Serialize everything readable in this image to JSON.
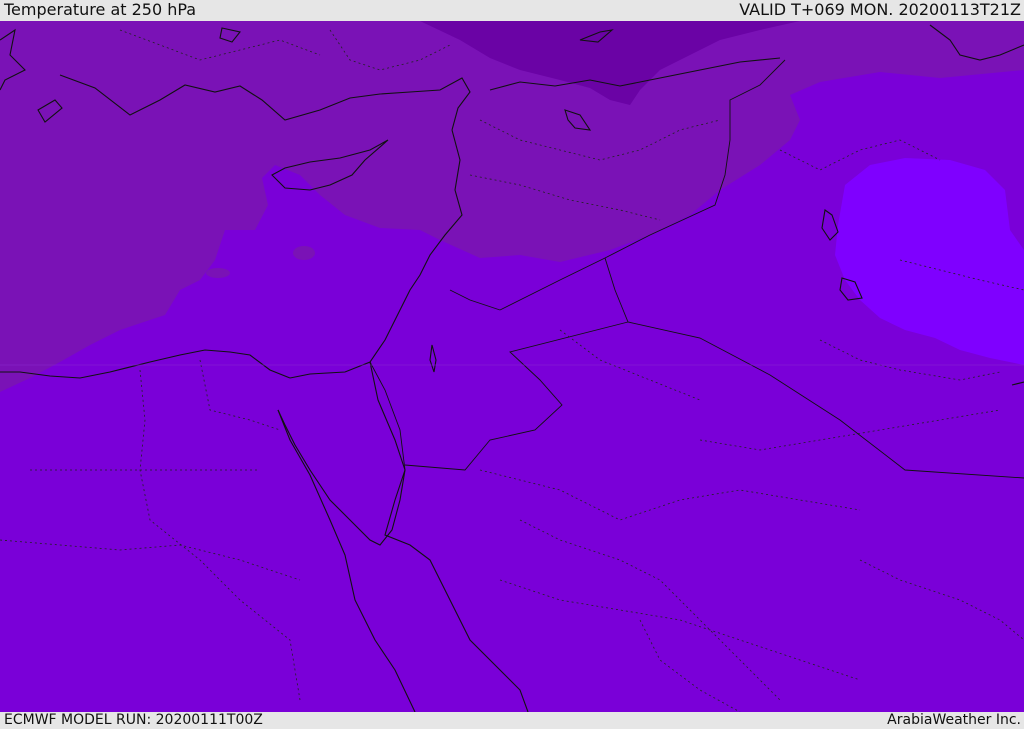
{
  "header": {
    "title": "Temperature at 250 hPa",
    "valid": "VALID T+069 MON. 20200113T21Z"
  },
  "footer": {
    "model_run": "ECMWF MODEL RUN: 20200111T00Z",
    "credit": "ArabiaWeather Inc."
  },
  "colors": {
    "base": "#7a00d8",
    "cold_1": "#7a12b6",
    "cold_2": "#6a03a5",
    "warm": "#7f00ff",
    "coast": "#111111",
    "border": "#111111"
  },
  "map": {
    "field": "temperature",
    "level": "250 hPa",
    "region": "Eastern Mediterranean / Middle East"
  }
}
